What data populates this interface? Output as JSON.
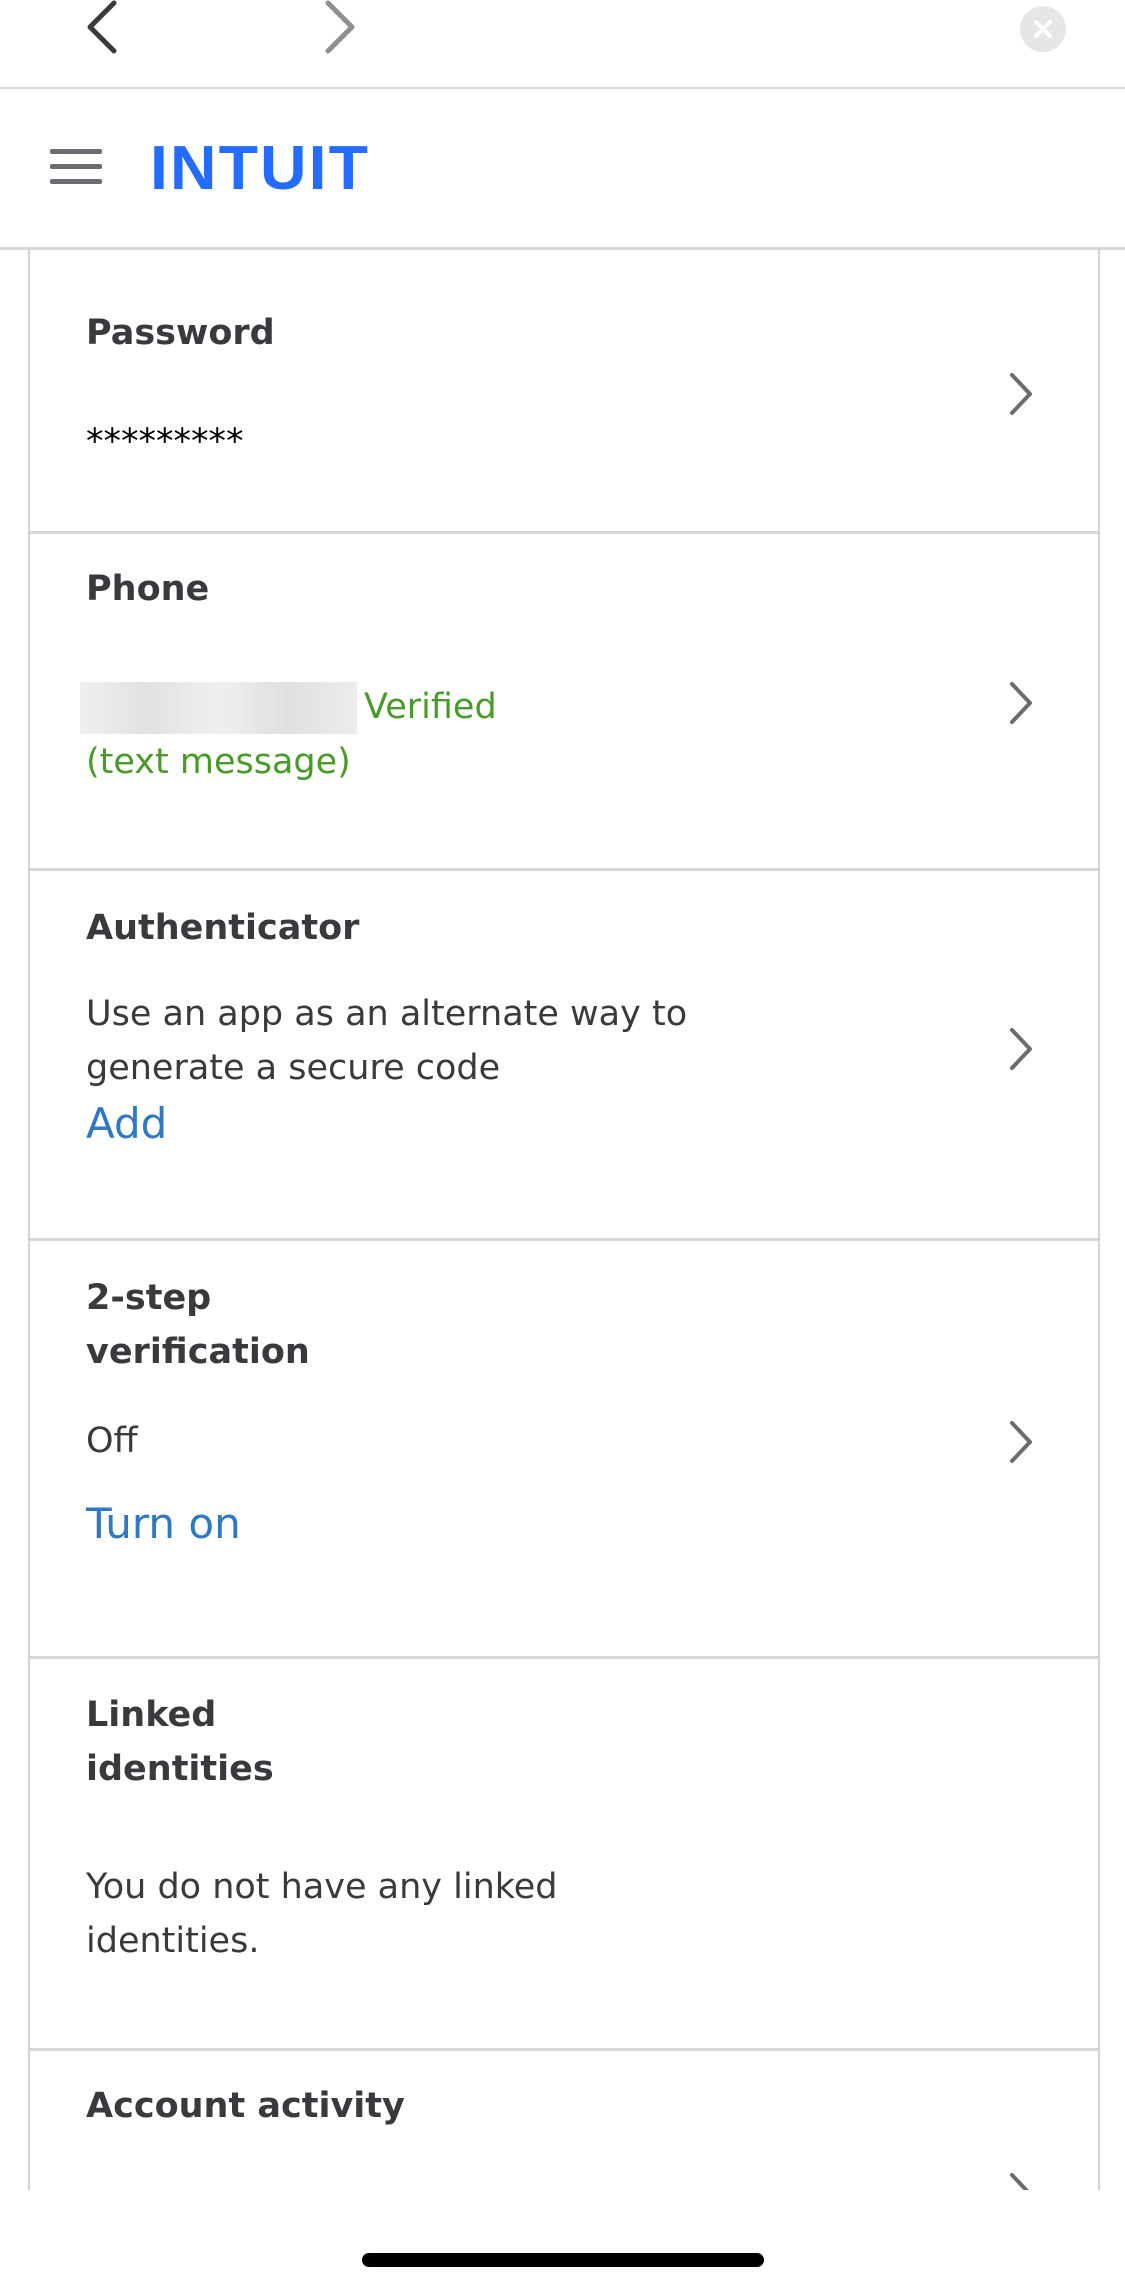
{
  "header": {
    "brand": "INTUIT"
  },
  "cards": {
    "password": {
      "title": "Password",
      "value": "*********"
    },
    "phone": {
      "title": "Phone",
      "status": "Verified",
      "method": "(text message)"
    },
    "authenticator": {
      "title": "Authenticator",
      "line1": "Use an app as an alternate way to",
      "line2": "generate a secure code",
      "action": "Add"
    },
    "two_step": {
      "title_line1": "2-step",
      "title_line2": "verification",
      "status": "Off",
      "action": "Turn on"
    },
    "linked": {
      "title_line1": "Linked",
      "title_line2": "identities",
      "line1": "You do not have any linked",
      "line2": "identities."
    },
    "activity": {
      "title": "Account activity"
    }
  },
  "icons": {
    "back": "chevron-left-icon",
    "forward": "chevron-right-icon",
    "close": "close-icon",
    "menu": "hamburger-icon",
    "row": "chevron-right-icon"
  },
  "colors": {
    "brand": "#236CFF",
    "link": "#2F78C4",
    "verified": "#4A9A2A",
    "text": "#393A3D"
  }
}
